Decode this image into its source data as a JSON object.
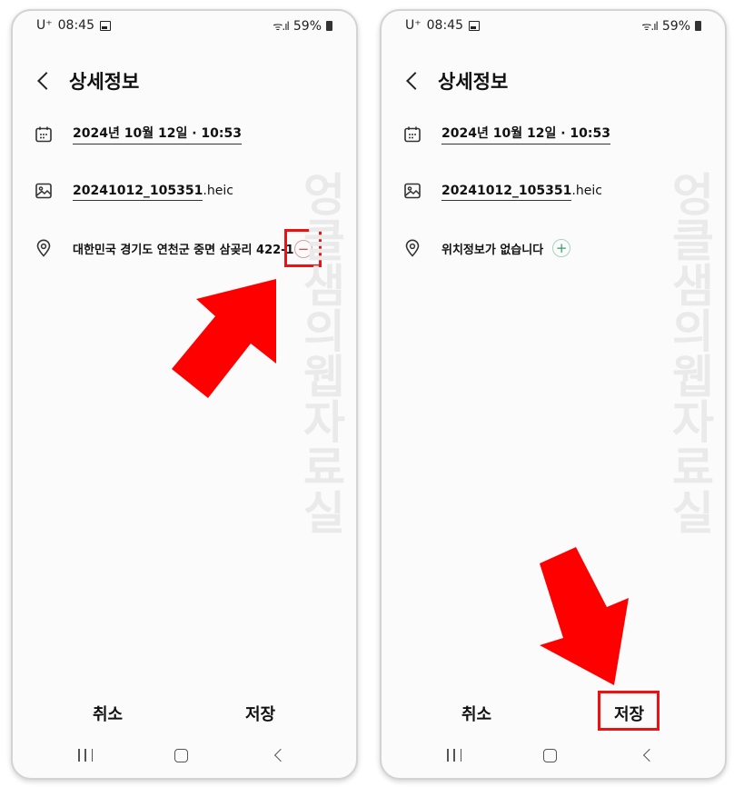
{
  "status_bar": {
    "carrier": "U⁺",
    "time": "08:45",
    "signal": "ᯤ.ıl",
    "battery": "59%"
  },
  "header": {
    "title": "상세정보"
  },
  "details": {
    "date": "2024년 10월 12일 · 10:53",
    "file_base": "20241012_105351",
    "file_ext": ".heic"
  },
  "left_screen": {
    "location": "대한민국 경기도 연천군 중면 삼곶리 422-1",
    "location_button": "−"
  },
  "right_screen": {
    "location": "위치정보가 없습니다",
    "location_button": "+"
  },
  "actions": {
    "cancel": "취소",
    "save": "저장"
  },
  "watermark": "엉클샘의웹자료실",
  "colors": {
    "highlight": "#e11111",
    "arrow": "#ff0000"
  },
  "icons": [
    "calendar-icon",
    "image-icon",
    "location-pin-icon",
    "minus-circle-icon",
    "plus-circle-icon",
    "back-chevron-icon",
    "recent-apps-icon",
    "home-icon",
    "nav-back-icon"
  ]
}
